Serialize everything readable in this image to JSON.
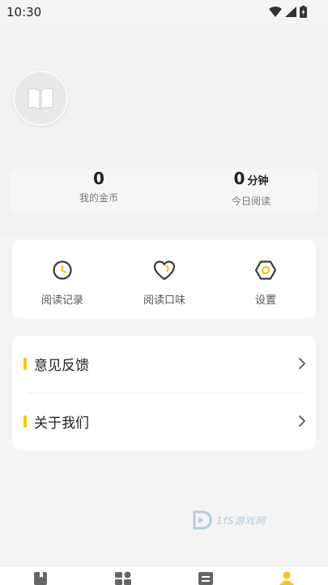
{
  "status": {
    "time": "10:30"
  },
  "stats": {
    "coins_value": "0",
    "coins_label": "我的金币",
    "reading_value": "0",
    "reading_unit": "分钟",
    "reading_label": "今日阅读"
  },
  "actions": [
    {
      "label": "阅读记录",
      "icon": "clock-icon"
    },
    {
      "label": "阅读口味",
      "icon": "heart-icon"
    },
    {
      "label": "设置",
      "icon": "settings-hexagon-icon"
    }
  ],
  "menu": [
    {
      "label": "意见反馈"
    },
    {
      "label": "关于我们"
    }
  ],
  "watermark": {
    "text": "1fS游戏网"
  },
  "tabbar": {
    "icons": [
      "bookshelf-icon",
      "category-icon",
      "list-icon",
      "profile-icon"
    ],
    "active_index": 3
  },
  "colors": {
    "accent": "#f5c518",
    "icon_stroke": "#3a3a3a",
    "background": "#f4f4f4"
  }
}
